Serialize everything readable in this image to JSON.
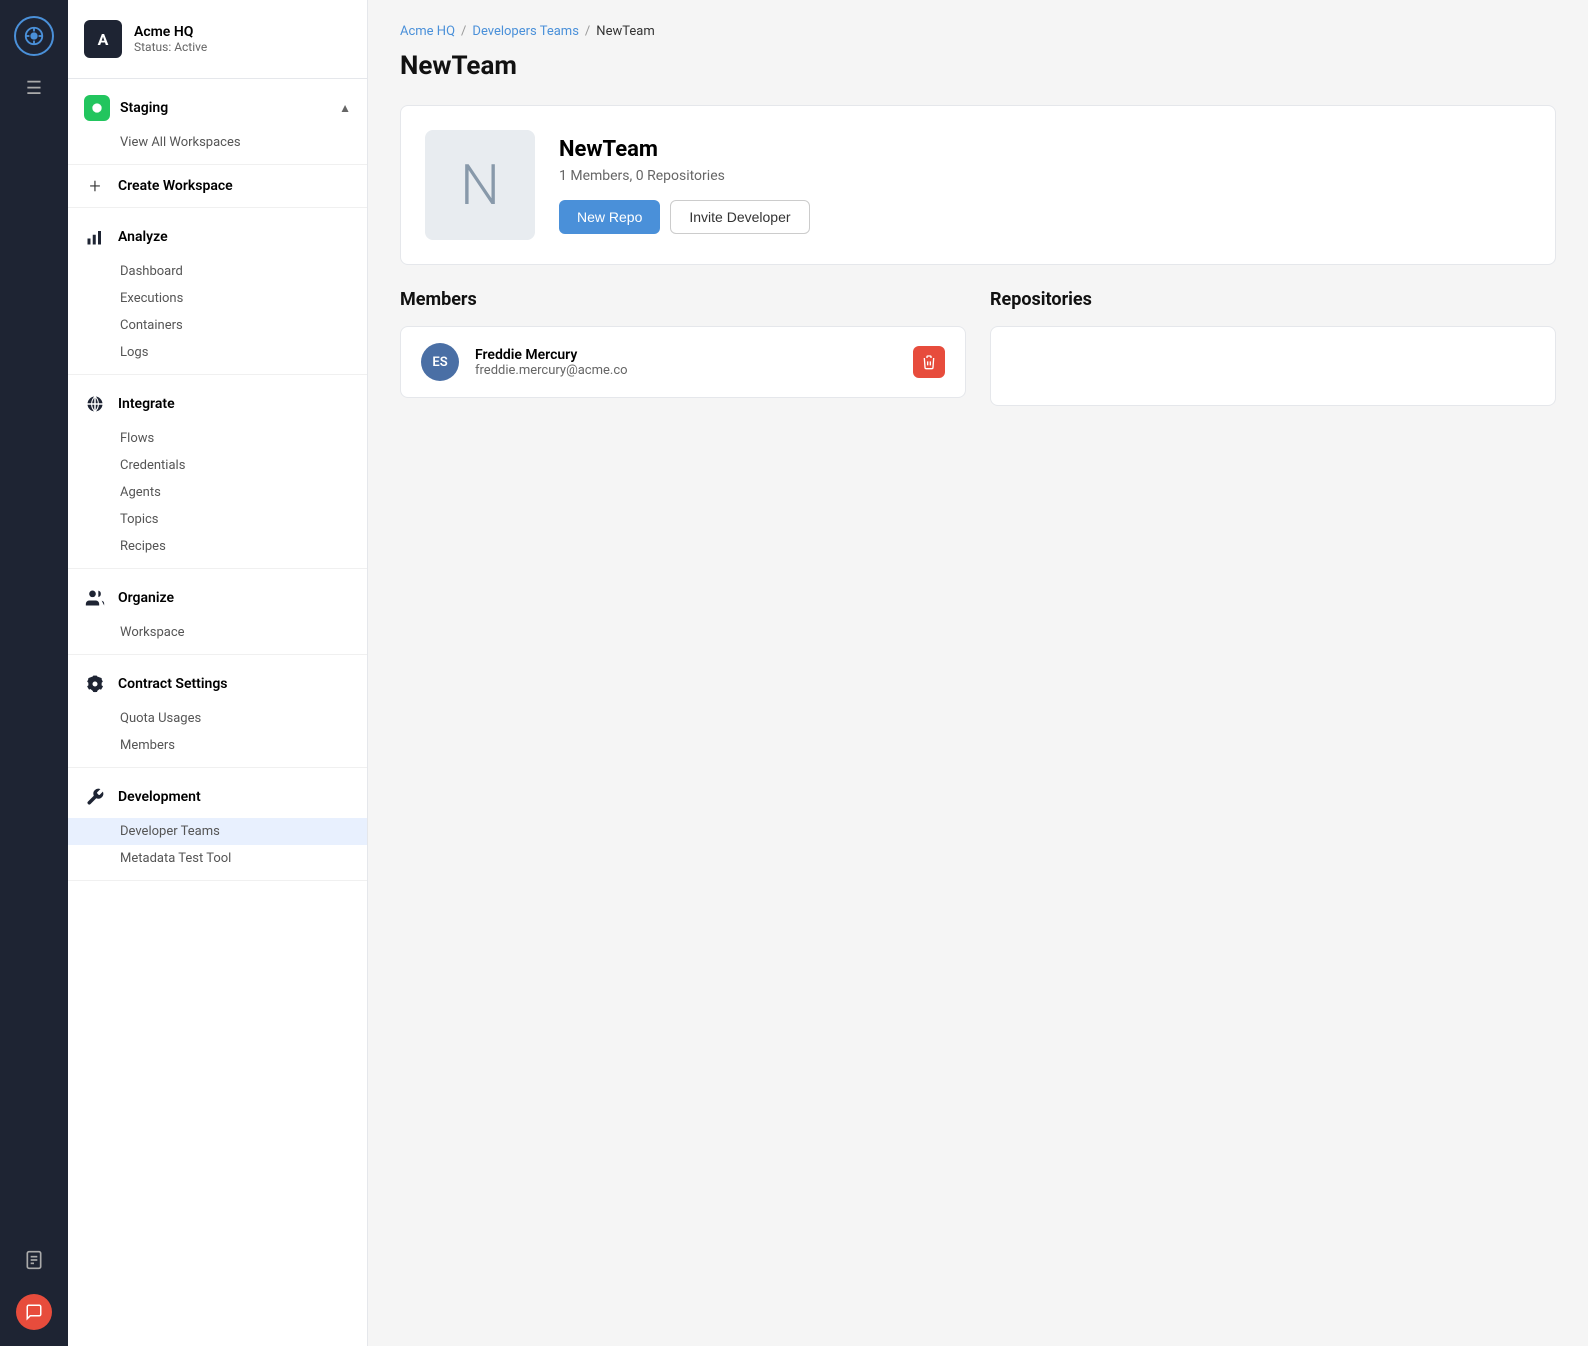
{
  "iconBar": {
    "logoAlt": "App Logo"
  },
  "sidebar": {
    "workspace": {
      "avatarLetter": "A",
      "name": "Acme HQ",
      "status": "Status: Active"
    },
    "staging": {
      "label": "Staging",
      "viewAllLabel": "View All Workspaces"
    },
    "createWorkspace": {
      "label": "Create Workspace"
    },
    "analyze": {
      "label": "Analyze",
      "links": [
        "Dashboard",
        "Executions",
        "Containers",
        "Logs"
      ]
    },
    "integrate": {
      "label": "Integrate",
      "links": [
        "Flows",
        "Credentials",
        "Agents",
        "Topics",
        "Recipes"
      ]
    },
    "organize": {
      "label": "Organize",
      "links": [
        "Workspace"
      ]
    },
    "contractSettings": {
      "label": "Contract Settings",
      "links": [
        "Quota Usages",
        "Members"
      ]
    },
    "development": {
      "label": "Development",
      "links": [
        "Developer Teams",
        "Metadata Test Tool"
      ]
    }
  },
  "breadcrumb": {
    "parts": [
      "Acme HQ",
      "Developers Teams",
      "NewTeam"
    ]
  },
  "pageTitle": "NewTeam",
  "teamCard": {
    "logoLetter": "N",
    "name": "NewTeam",
    "meta": "1 Members, 0 Repositories",
    "newRepoBtn": "New Repo",
    "inviteBtn": "Invite Developer"
  },
  "members": {
    "title": "Members",
    "list": [
      {
        "initials": "ES",
        "name": "Freddie Mercury",
        "email": "freddie.mercury@acme.co"
      }
    ]
  },
  "repositories": {
    "title": "Repositories"
  }
}
